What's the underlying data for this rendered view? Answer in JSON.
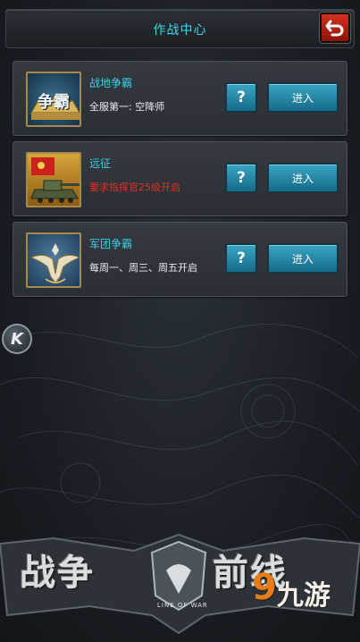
{
  "header": {
    "title": "作战中心"
  },
  "cards": [
    {
      "title": "战地争霸",
      "subtitle": "全服第一: 空降师",
      "subtitle_warn": false,
      "help": "?",
      "enter": "进入",
      "emblem_text": "争霸"
    },
    {
      "title": "远征",
      "subtitle": "要求指挥官25级开启",
      "subtitle_warn": true,
      "help": "?",
      "enter": "进入"
    },
    {
      "title": "军团争霸",
      "subtitle": "每周一、周三、周五开启",
      "subtitle_warn": false,
      "help": "?",
      "enter": "进入"
    }
  ],
  "side": {
    "label": "K"
  },
  "logo": {
    "left": "战争",
    "right": "前线",
    "sub": "LINE OF WAR"
  },
  "watermark": {
    "nine": "9",
    "text": "九游"
  },
  "colors": {
    "accent": "#39d0e4",
    "warn": "#e2301e",
    "button": "#2a8fb0",
    "back": "#c82a1a"
  }
}
